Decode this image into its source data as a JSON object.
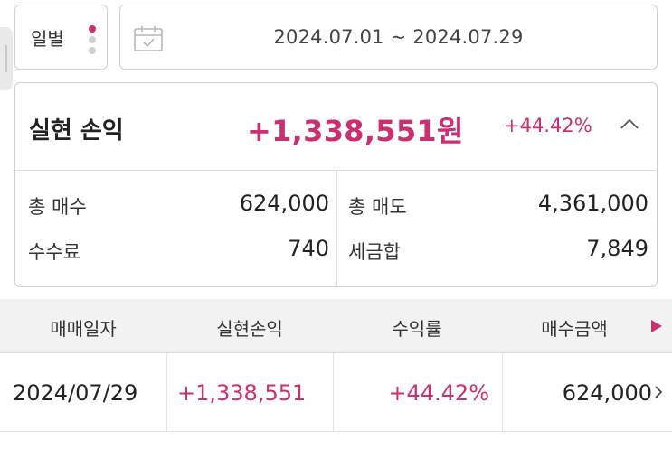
{
  "filter": {
    "period_label": "일별",
    "date_range": "2024.07.01 ~ 2024.07.29"
  },
  "summary": {
    "title": "실현 손익",
    "profit_amount": "+1,338,551원",
    "profit_rate": "+44.42%",
    "items": {
      "buy_total_label": "총 매수",
      "buy_total_value": "624,000",
      "sell_total_label": "총 매도",
      "sell_total_value": "4,361,000",
      "fee_label": "수수료",
      "fee_value": "740",
      "tax_label": "세금합",
      "tax_value": "7,849"
    }
  },
  "table": {
    "headers": [
      "매매일자",
      "실현손익",
      "수익률",
      "매수금액"
    ],
    "rows": [
      {
        "date": "2024/07/29",
        "profit": "+1,338,551",
        "rate": "+44.42%",
        "buy_amount": "624,000"
      }
    ]
  },
  "colors": {
    "accent": "#cc2e72",
    "border": "#cfcfcf",
    "header_bg": "#f2f2f2"
  },
  "icons": {
    "period_menu": "vertical-dots-icon",
    "date": "calendar-icon",
    "collapse": "chevron-up-icon",
    "scroll_columns": "play-right-icon",
    "row_detail": "chevron-right-icon"
  }
}
